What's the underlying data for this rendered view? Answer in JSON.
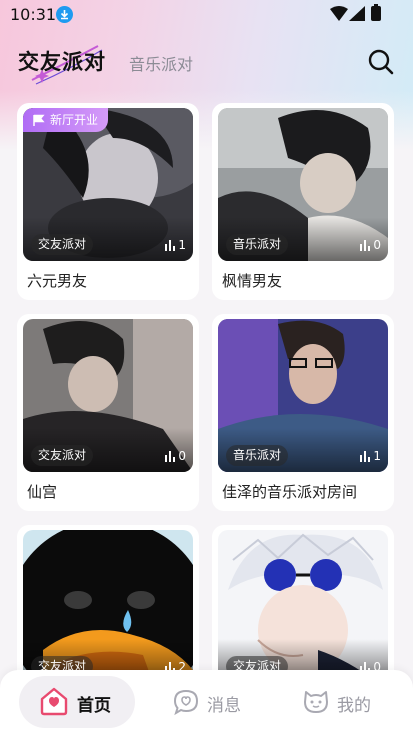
{
  "status_bar": {
    "time": "10:31"
  },
  "header": {
    "tabs": [
      {
        "label": "交友派对",
        "active": true
      },
      {
        "label": "音乐派对",
        "active": false
      }
    ]
  },
  "rooms": [
    {
      "title": "六元男友",
      "category": "交友派对",
      "count": "1",
      "badge": "新厅开业"
    },
    {
      "title": "枫情男友",
      "category": "音乐派对",
      "count": "0"
    },
    {
      "title": "仙宫",
      "category": "交友派对",
      "count": "0"
    },
    {
      "title": "佳泽的音乐派对房间",
      "category": "音乐派对",
      "count": "1"
    },
    {
      "title": "",
      "category": "交友派对",
      "count": "2"
    },
    {
      "title": "",
      "category": "交友派对",
      "count": "0"
    }
  ],
  "bottom_nav": {
    "items": [
      {
        "label": "首页",
        "icon": "house-icon",
        "active": true
      },
      {
        "label": "消息",
        "icon": "chat-heart-icon",
        "active": false
      },
      {
        "label": "我的",
        "icon": "cat-face-icon",
        "active": false
      }
    ]
  },
  "colors": {
    "accent": "#b06cf5",
    "nav_active_bg": "#f1eff3",
    "home_icon": "#e84a6f"
  }
}
